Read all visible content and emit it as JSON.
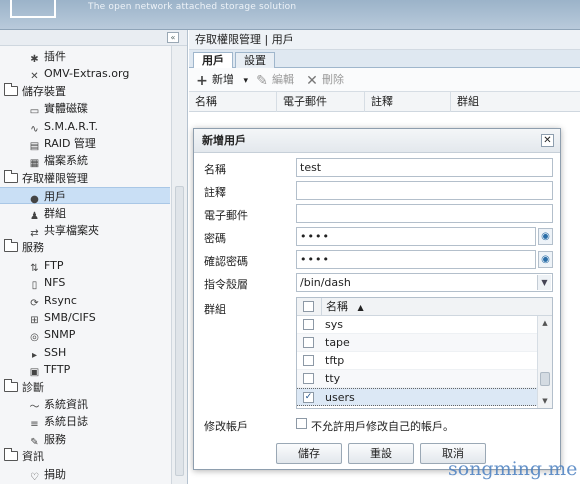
{
  "header": {
    "tagline": "The open network attached storage solution"
  },
  "sidebar": {
    "collapse_icon": "«",
    "nodes": [
      {
        "label": "插件",
        "type": "leaf",
        "icon": "puzzle-icon"
      },
      {
        "label": "OMV-Extras.org",
        "type": "leaf",
        "icon": "tools-icon"
      },
      {
        "label": "儲存裝置",
        "type": "category"
      },
      {
        "label": "實體磁碟",
        "type": "leaf",
        "icon": "disk-icon"
      },
      {
        "label": "S.M.A.R.T.",
        "type": "leaf",
        "icon": "pulse-icon"
      },
      {
        "label": "RAID 管理",
        "type": "leaf",
        "icon": "raid-icon"
      },
      {
        "label": "檔案系統",
        "type": "leaf",
        "icon": "filesystem-icon"
      },
      {
        "label": "存取權限管理",
        "type": "category"
      },
      {
        "label": "用戶",
        "type": "leaf",
        "icon": "user-icon",
        "selected": true
      },
      {
        "label": "群組",
        "type": "leaf",
        "icon": "group-icon"
      },
      {
        "label": "共享檔案夾",
        "type": "leaf",
        "icon": "share-icon"
      },
      {
        "label": "服務",
        "type": "category"
      },
      {
        "label": "FTP",
        "type": "leaf",
        "icon": "ftp-icon"
      },
      {
        "label": "NFS",
        "type": "leaf",
        "icon": "nfs-icon"
      },
      {
        "label": "Rsync",
        "type": "leaf",
        "icon": "rsync-icon"
      },
      {
        "label": "SMB/CIFS",
        "type": "leaf",
        "icon": "smb-icon"
      },
      {
        "label": "SNMP",
        "type": "leaf",
        "icon": "snmp-icon"
      },
      {
        "label": "SSH",
        "type": "leaf",
        "icon": "terminal-icon"
      },
      {
        "label": "TFTP",
        "type": "leaf",
        "icon": "tftp-icon"
      },
      {
        "label": "診斷",
        "type": "category"
      },
      {
        "label": "系統資訊",
        "type": "leaf",
        "icon": "chart-icon"
      },
      {
        "label": "系統日誌",
        "type": "leaf",
        "icon": "log-icon"
      },
      {
        "label": "服務",
        "type": "leaf",
        "icon": "wrench-icon"
      },
      {
        "label": "資訊",
        "type": "category"
      },
      {
        "label": "捐助",
        "type": "leaf",
        "icon": "heart-icon"
      }
    ]
  },
  "main": {
    "breadcrumb": "存取權限管理 | 用戶",
    "tabs": [
      {
        "label": "用戶",
        "active": true
      },
      {
        "label": "設置",
        "active": false
      }
    ],
    "toolbar": {
      "add": "新增",
      "add_icon": "+",
      "edit": "編輯",
      "edit_icon": "✎",
      "delete": "刪除",
      "delete_icon": "✕",
      "dropdown_icon": "▾"
    },
    "columns": [
      "名稱",
      "電子郵件",
      "註釋",
      "群組"
    ]
  },
  "dialog": {
    "title": "新增用戶",
    "close_icon": "✕",
    "fields": {
      "name_label": "名稱",
      "name_value": "test",
      "comment_label": "註釋",
      "comment_value": "",
      "email_label": "電子郵件",
      "email_value": "",
      "password_label": "密碼",
      "password_value": "••••",
      "confirm_label": "確認密碼",
      "confirm_value": "••••",
      "shell_label": "指令殼層",
      "shell_value": "/bin/dash",
      "groups_label": "群組",
      "modify_label": "修改帳戶",
      "modify_checkbox_text": "不允許用戶修改自己的帳戶。"
    },
    "groups": {
      "column": "名稱",
      "sort_icon": "▲",
      "rows": [
        {
          "name": "sys",
          "checked": false
        },
        {
          "name": "tape",
          "checked": false
        },
        {
          "name": "tftp",
          "checked": false
        },
        {
          "name": "tty",
          "checked": false
        },
        {
          "name": "users",
          "checked": true
        }
      ]
    },
    "buttons": {
      "save": "儲存",
      "reset": "重設",
      "cancel": "取消"
    }
  },
  "watermark": "songming.me"
}
